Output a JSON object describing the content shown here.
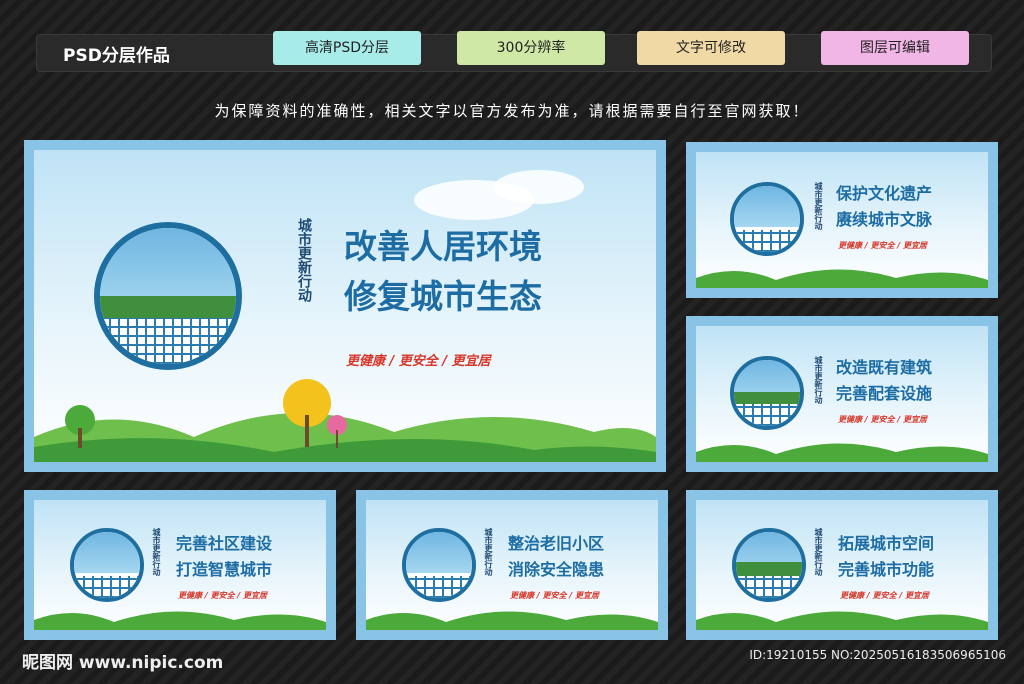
{
  "header": {
    "title": "PSD分层作品",
    "tags": [
      "高清PSD分层",
      "300分辨率",
      "文字可修改",
      "图层可编辑"
    ]
  },
  "notice": "为保障资料的准确性，相关文字以官方发布为准，请根据需要自行至官网获取！",
  "boards": [
    {
      "vertical": "城市更新行动",
      "line1": "改善人居环境",
      "line2": "修复城市生态",
      "slogan": "更健康 / 更安全 / 更宜居"
    },
    {
      "vertical": "城市更新行动",
      "line1": "保护文化遗产",
      "line2": "赓续城市文脉",
      "slogan": "更健康 / 更安全 / 更宜居"
    },
    {
      "vertical": "城市更新行动",
      "line1": "改造既有建筑",
      "line2": "完善配套设施",
      "slogan": "更健康 / 更安全 / 更宜居"
    },
    {
      "vertical": "城市更新行动",
      "line1": "完善社区建设",
      "line2": "打造智慧城市",
      "slogan": "更健康 / 更安全 / 更宜居"
    },
    {
      "vertical": "城市更新行动",
      "line1": "整治老旧小区",
      "line2": "消除安全隐患",
      "slogan": "更健康 / 更安全 / 更宜居"
    },
    {
      "vertical": "城市更新行动",
      "line1": "拓展城市空间",
      "line2": "完善城市功能",
      "slogan": "更健康 / 更安全 / 更宜居"
    }
  ],
  "watermark": {
    "left": "昵图网 www.nipic.com",
    "right": "ID:19210155 NO:20250516183506965106"
  }
}
